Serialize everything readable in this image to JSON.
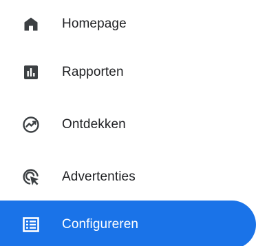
{
  "nav": {
    "items": [
      {
        "label": "Homepage",
        "icon": "home-icon",
        "active": false
      },
      {
        "label": "Rapporten",
        "icon": "bar-chart-icon",
        "active": false
      },
      {
        "label": "Ontdekken",
        "icon": "explore-icon",
        "active": false
      },
      {
        "label": "Advertenties",
        "icon": "ads-click-icon",
        "active": false
      },
      {
        "label": "Configureren",
        "icon": "list-icon",
        "active": true
      }
    ]
  },
  "colors": {
    "active_bg": "#1a73e8",
    "active_text": "#ffffff",
    "text": "#202124",
    "icon": "#3c4043"
  }
}
